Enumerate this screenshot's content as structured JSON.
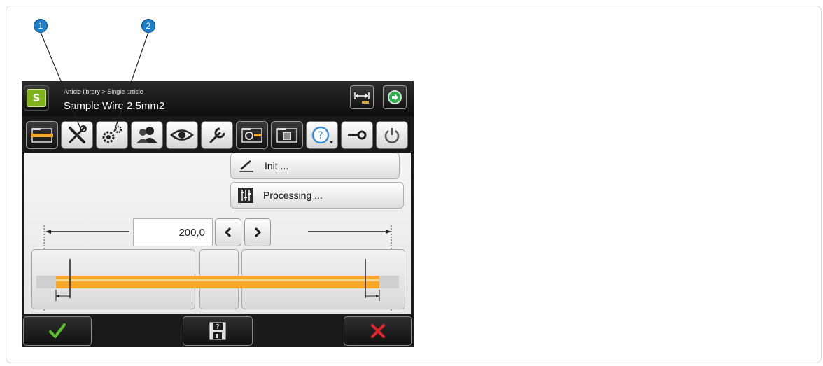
{
  "callouts": [
    "1",
    "2"
  ],
  "header": {
    "logo_text": "S",
    "breadcrumb": "Article library > Single article",
    "article_name": "Sample Wire 2.5mm2",
    "right_buttons": [
      "length-measure-icon",
      "forward-icon"
    ]
  },
  "toolbar": {
    "tools": [
      "wire-folder-icon",
      "tools-icon",
      "settings-gears-icon",
      "users-icon",
      "eye-icon",
      "wrench-icon",
      "camera-folder-icon",
      "processing-folder-icon",
      "help-icon",
      "key-icon",
      "power-icon"
    ]
  },
  "menu": {
    "init_label": "Init ...",
    "processing_label": "Processing ..."
  },
  "length": {
    "value": "200,0",
    "decrease_icon": "chevron-left-icon",
    "increase_icon": "chevron-right-icon"
  },
  "bottom": {
    "confirm_icon": "checkmark-icon",
    "save_icon": "save-question-icon",
    "cancel_icon": "cross-icon"
  },
  "colors": {
    "wire": "#f7a829",
    "accent_green": "#7fb31c",
    "callout": "#1e7ec8",
    "cancel_red": "#e0262a",
    "confirm_green": "#5bbf2d"
  }
}
